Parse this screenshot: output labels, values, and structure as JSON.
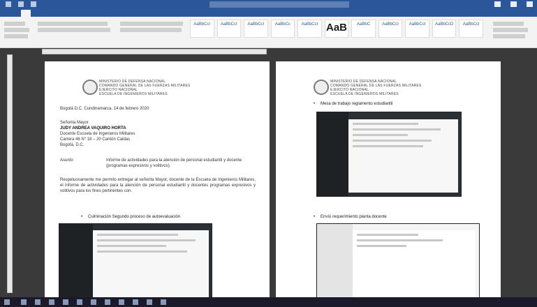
{
  "document": {
    "header_lines": [
      "MINISTERIO DE DEFENSA NACIONAL",
      "COMANDO GENERAL DE LAS FUERZAS MILITARES",
      "EJERCITO NACIONAL",
      "ESCUELA DE INGENIEROS MILITARES"
    ],
    "date_line": "Bogotá D.C. Cundinamarca, 14 de febrero 2020",
    "recipient_title": "Señorita Mayor",
    "recipient_name": "JUDY ANDREA VAQUIRO HORTA",
    "recipient_role": "Docente Escuela de Ingenieros Militares",
    "recipient_address": "Carrera 46 N° 18 – 20 Cantón Caldas",
    "recipient_city": "Bogotá, D.C.",
    "subject_label": "Asunto",
    "subject_text": "Informe de actividades para la atención de personal estudiantil y docente (programas expresivos y volitivos).",
    "body_text": "Respetuosamente me permito entregar al señorita Mayor, docente de la Escuela de Ingenieros Militares, el informe de actividades para la atención de personal estudiantil y docentes programas expresivos y volitivos para los fines pertinentes con.",
    "bullet_p1": "Culminación Segundo proceso de autoevaluación",
    "bullet_p2a": "Mesa de trabajo reglamento estudiantil",
    "bullet_p2b": "Envío requerimiento planta docente"
  },
  "ribbon": {
    "big_style": "AaB",
    "style_names": [
      "AaBbCcI",
      "AaBbCcI",
      "AaBbCcI",
      "AaBbCc",
      "AaBbCcI",
      "AaBbC",
      "AaBbCcI",
      "AaBbCcI",
      "AaBbCcD",
      "AaBbCcI"
    ]
  }
}
